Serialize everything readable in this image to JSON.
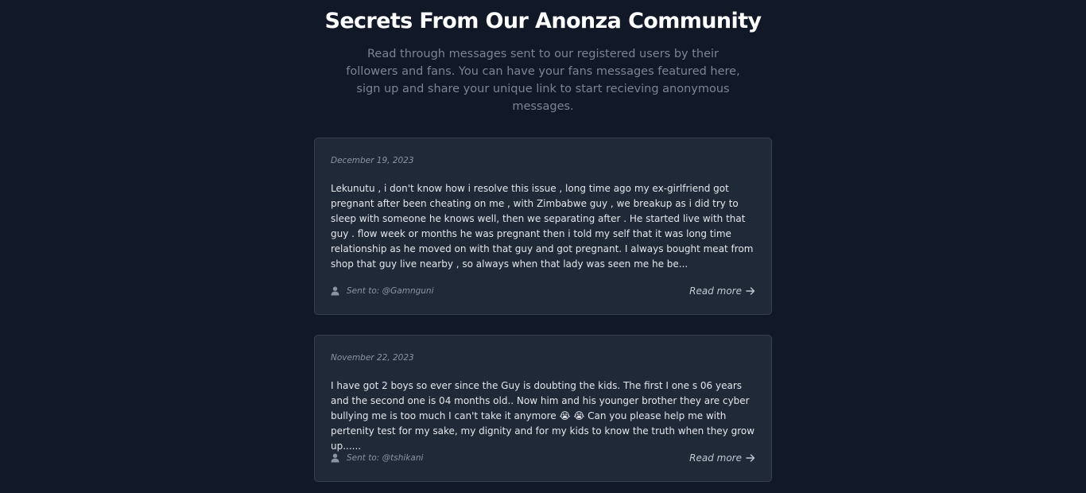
{
  "header": {
    "title": "Secrets From Our Anonza Community",
    "subtitle": "Read through messages sent to our registered users by their followers and fans. You can have your fans messages featured here, sign up and share your unique link to start recieving anonymous messages."
  },
  "messages": [
    {
      "date": "December 19, 2023",
      "body": "Lekunutu , i don't know how i resolve this issue , long time ago my ex-girlfriend got pregnant after been cheating on me , with Zimbabwe guy , we breakup as i did try to sleep with someone he knows well, then we separating after . He started live with that guy . flow week or months he was pregnant then i told my self that it was long time relationship as he moved on with that guy and got pregnant. I always bought meat from shop that guy live nearby , so always when that lady was seen me he be...",
      "sent_to": "Sent to: @Gamnguni",
      "read_more": "Read more",
      "user_icon": "user-icon",
      "arrow_icon": "arrow-right-icon"
    },
    {
      "date": "November 22, 2023",
      "body": "I have got 2 boys so ever since the Guy is doubting the kids. The first I one s 06 years and the second one is 04 months old.. Now him and his younger brother they are cyber bullying me is too much I can't take it anymore 😭 😭 Can you please help me with pertenity test for my sake, my dignity and for my kids to know the truth when they grow up......",
      "sent_to": "Sent to: @tshikani",
      "read_more": "Read more",
      "user_icon": "user-icon",
      "arrow_icon": "arrow-right-icon"
    }
  ],
  "colors": {
    "background": "#111827",
    "card": "#1f2937",
    "card_border": "#374151",
    "muted_text": "#8b94a3"
  }
}
